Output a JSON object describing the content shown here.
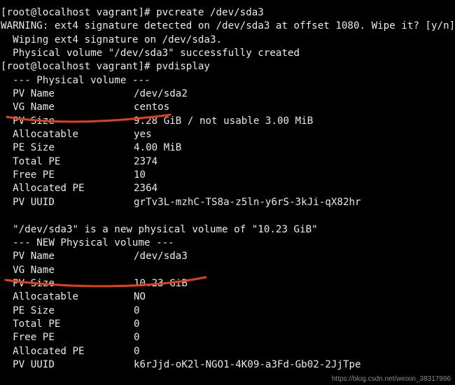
{
  "terminal": {
    "lines": [
      "[root@localhost vagrant]# pvcreate /dev/sda3",
      "WARNING: ext4 signature detected on /dev/sda3 at offset 1080. Wipe it? [y/n]: y",
      "  Wiping ext4 signature on /dev/sda3.",
      "  Physical volume \"/dev/sda3\" successfully created",
      "[root@localhost vagrant]# pvdisplay",
      "  --- Physical volume ---"
    ],
    "pv1": [
      {
        "key": "PV Name",
        "value": "/dev/sda2"
      },
      {
        "key": "VG Name",
        "value": "centos"
      },
      {
        "key": "PV Size",
        "value": "9.28 GiB / not usable 3.00 MiB"
      },
      {
        "key": "Allocatable",
        "value": "yes"
      },
      {
        "key": "PE Size",
        "value": "4.00 MiB"
      },
      {
        "key": "Total PE",
        "value": "2374"
      },
      {
        "key": "Free PE",
        "value": "10"
      },
      {
        "key": "Allocated PE",
        "value": "2364"
      },
      {
        "key": "PV UUID",
        "value": "grTv3L-mzhC-TS8a-z5ln-y6rS-3kJi-qX82hr"
      }
    ],
    "new_pv_notice": "  \"/dev/sda3\" is a new physical volume of \"10.23 GiB\"",
    "new_pv_header": "  --- NEW Physical volume ---",
    "pv2": [
      {
        "key": "PV Name",
        "value": "/dev/sda3"
      },
      {
        "key": "VG Name",
        "value": ""
      },
      {
        "key": "PV Size",
        "value": "10.23 GiB"
      },
      {
        "key": "Allocatable",
        "value": "NO"
      },
      {
        "key": "PE Size",
        "value": "0"
      },
      {
        "key": "Total PE",
        "value": "0"
      },
      {
        "key": "Free PE",
        "value": "0"
      },
      {
        "key": "Allocated PE",
        "value": "0"
      },
      {
        "key": "PV UUID",
        "value": "k6rJjd-oK2l-NGO1-4K09-a3Fd-Gb02-2JjTpe"
      }
    ]
  },
  "watermark": "https://blog.csdn.net/weixin_38317996",
  "colors": {
    "background": "#000000",
    "text": "#e9e9e9",
    "annotation": "#e0401c"
  }
}
